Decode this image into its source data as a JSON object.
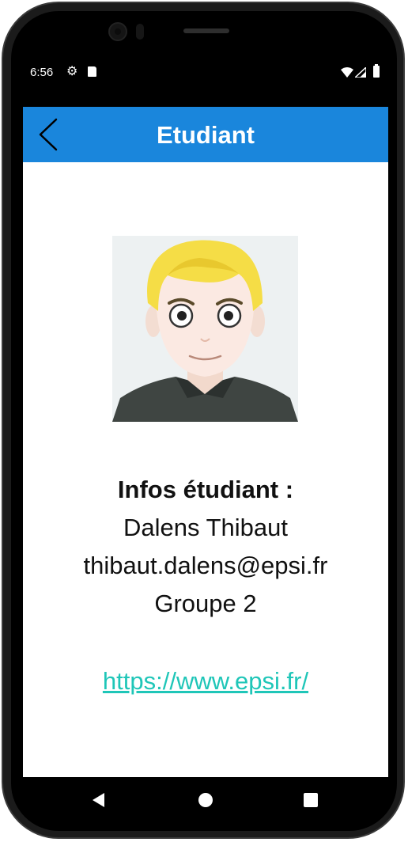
{
  "status_bar": {
    "time": "6:56",
    "icons": [
      "gear-icon",
      "sd-card-icon",
      "wifi-icon",
      "signal-icon",
      "battery-icon"
    ]
  },
  "app_bar": {
    "title": "Etudiant",
    "back_icon": "chevron-left-icon",
    "background_color": "#1a86dc"
  },
  "student": {
    "avatar": "student-avatar",
    "heading": "Infos étudiant :",
    "name": "Dalens Thibaut",
    "email": "thibaut.dalens@epsi.fr",
    "group": "Groupe 2"
  },
  "link": {
    "text": "https://www.epsi.fr/",
    "color": "#1fc6b8"
  },
  "nav_bar": {
    "icons": [
      "back-triangle-icon",
      "home-circle-icon",
      "recents-square-icon"
    ]
  }
}
